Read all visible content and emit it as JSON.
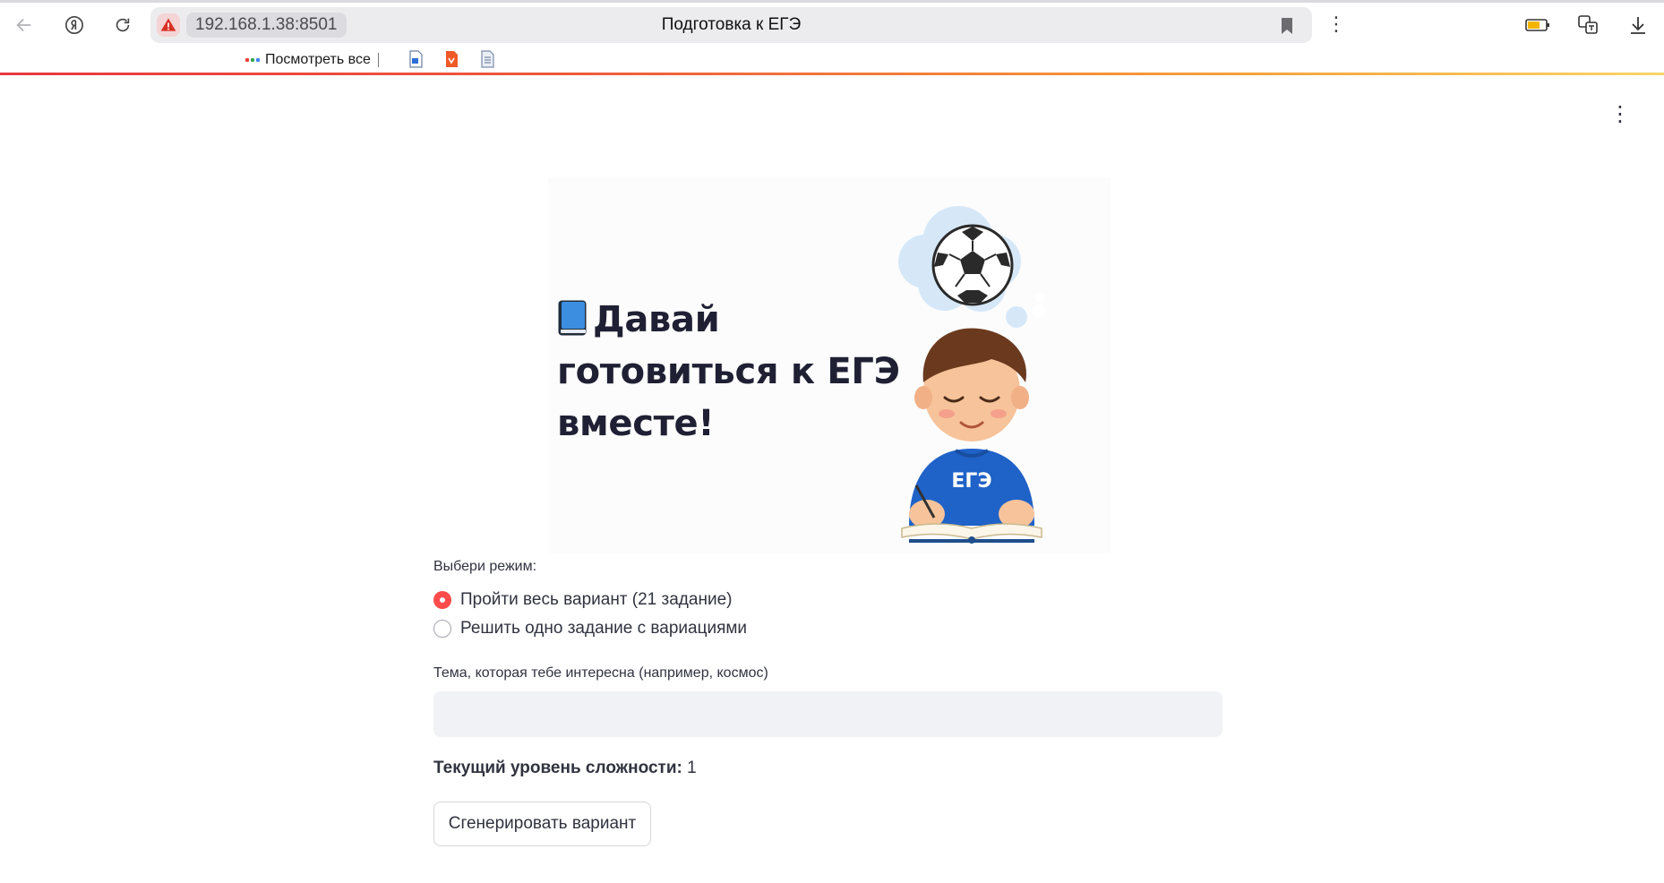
{
  "browser": {
    "url": "192.168.1.38:8501",
    "tab_title": "Подготовка к ЕГЭ",
    "bookmarks": {
      "view_all_label": "Посмотреть все"
    }
  },
  "app": {
    "title_line1": "Давай",
    "title_line2": "готовиться к ЕГЭ",
    "title_line3": "вместе!",
    "shirt_text": "ЕГЭ",
    "mode": {
      "label": "Выбери режим:",
      "options": [
        "Пройти весь вариант (21 задание)",
        "Решить одно задание с вариациями"
      ],
      "selected_index": 0
    },
    "topic": {
      "label": "Тема, которая тебе интересна (например, космос)",
      "value": "",
      "placeholder": ""
    },
    "level": {
      "label": "Текущий уровень сложности:",
      "value": "1"
    },
    "generate_button_label": "Сгенерировать вариант"
  },
  "colors": {
    "accent": "#ff4b4b",
    "text": "#31333f",
    "title": "#1f2033",
    "input_bg": "#f0f2f6",
    "shirt": "#1f62c8"
  }
}
